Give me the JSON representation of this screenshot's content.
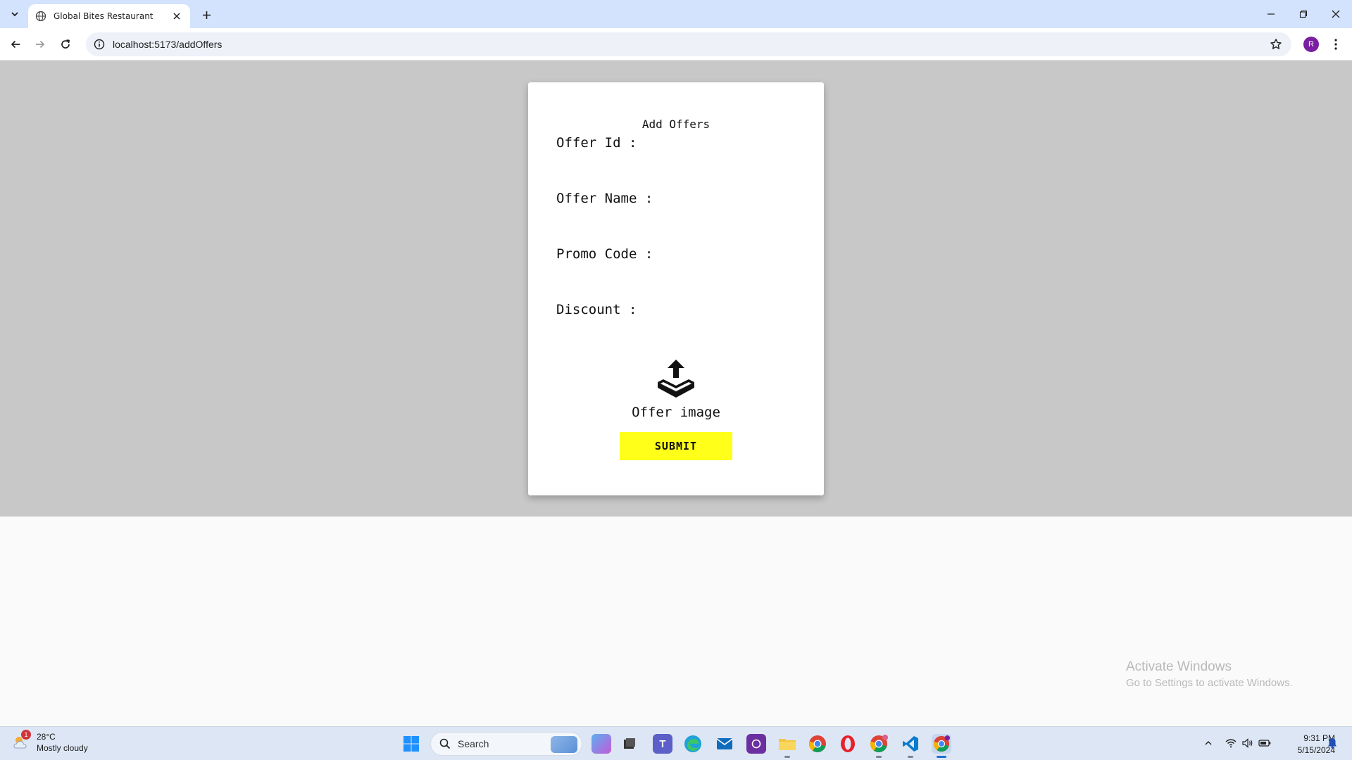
{
  "browser": {
    "tab_title": "Global Bites Restaurant",
    "url": "localhost:5173/addOffers",
    "profile_initial": "R"
  },
  "form": {
    "title": "Add Offers",
    "fields": [
      {
        "label": "Offer Id :"
      },
      {
        "label": "Offer Name :"
      },
      {
        "label": "Promo Code :"
      },
      {
        "label": "Discount :"
      }
    ],
    "upload_label": "Offer image",
    "submit_label": "SUBMIT"
  },
  "watermark": {
    "title": "Activate Windows",
    "subtitle": "Go to Settings to activate Windows."
  },
  "taskbar": {
    "weather_temp": "28°C",
    "weather_desc": "Mostly cloudy",
    "weather_badge": "1",
    "search_placeholder": "Search",
    "time": "9:31 PM",
    "date": "5/15/2024"
  },
  "colors": {
    "submit_bg": "#ffff1a",
    "page_overlay": "#c8c8c8",
    "tabbar": "#d3e3fd"
  }
}
